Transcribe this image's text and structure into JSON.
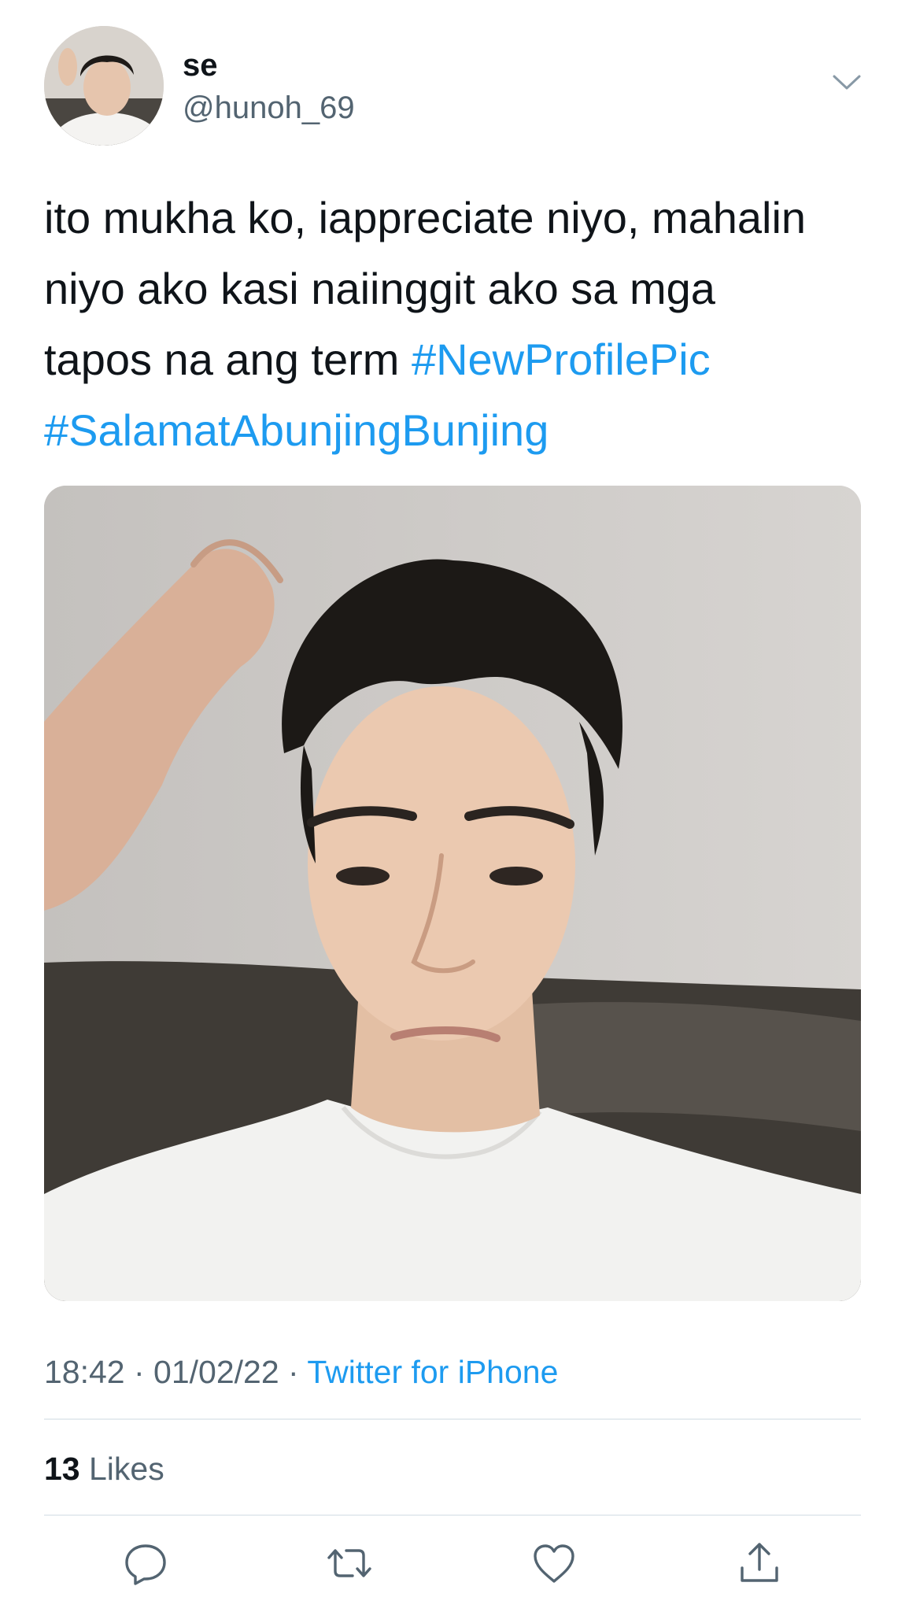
{
  "user": {
    "display_name": "se",
    "handle": "@hunoh_69"
  },
  "tweet": {
    "text_line_1": "ito mukha ko, iappreciate niyo, mahalin",
    "text_line_2": "niyo ako kasi naiinggit ako sa mga",
    "text_line_3": "tapos na ang term ",
    "hashtag_1": "#NewProfilePic",
    "hashtag_2": "#SalamatAbunjingBunjing"
  },
  "meta": {
    "time": "18:42",
    "date": "01/02/22",
    "separator": " · ",
    "source": "Twitter for iPhone"
  },
  "stats": {
    "likes_count": "13",
    "likes_label": " Likes"
  },
  "icons": {
    "reply": "reply-icon",
    "retweet": "retweet-icon",
    "like": "heart-icon",
    "share": "share-icon",
    "chevron": "chevron-down-icon"
  },
  "colors": {
    "link": "#1d9bf0",
    "secondary_text": "#536471",
    "primary_text": "#0f1419",
    "divider": "#e6ecf0"
  }
}
